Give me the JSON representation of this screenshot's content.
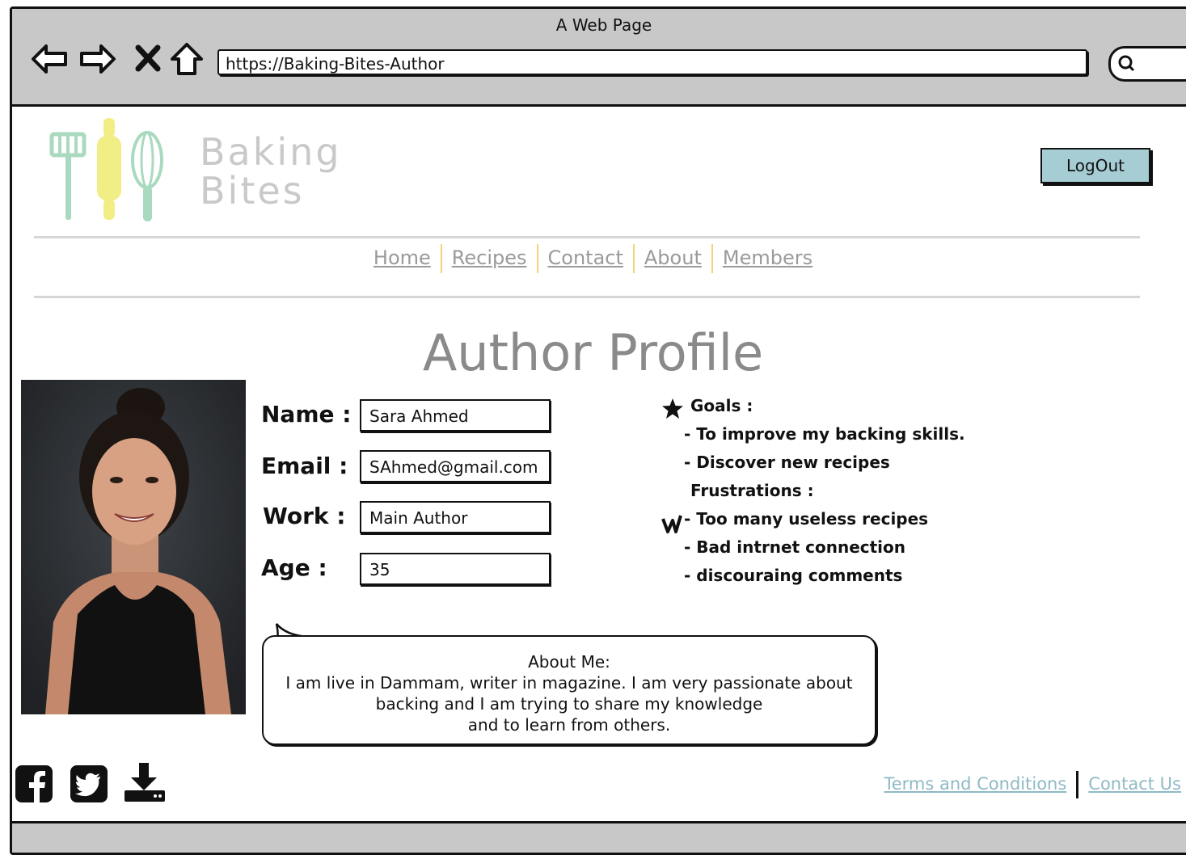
{
  "window": {
    "title": "A Web Page"
  },
  "browser": {
    "url": "https://Baking-Bites-Author"
  },
  "logo": {
    "line1": "Baking",
    "line2": "Bites"
  },
  "header": {
    "logout_label": "LogOut"
  },
  "nav": {
    "items": [
      "Home",
      "Recipes",
      "Contact",
      "About",
      "Members"
    ]
  },
  "page": {
    "title": "Author Profile"
  },
  "profile": {
    "name_label": "Name :",
    "name_value": "Sara Ahmed",
    "email_label": "Email :",
    "email_value": "SAhmed@gmail.com",
    "work_label": "Work :",
    "work_value": "Main Author",
    "age_label": "Age :",
    "age_value": "35"
  },
  "notes": {
    "goals_title": "Goals :",
    "goals": [
      "- To improve my backing skills.",
      "- Discover new recipes"
    ],
    "frustrations_title": "Frustrations :",
    "frustrations": [
      "- Too many useless recipes",
      "- Bad intrnet connection",
      "- discouraing comments"
    ]
  },
  "about": {
    "title": "About Me:",
    "lines": [
      "I am live in Dammam, writer in magazine. I am very passionate about",
      "backing and I am trying to share my knowledge",
      "and to learn from others."
    ]
  },
  "footer": {
    "terms": "Terms and Conditions",
    "contact": "Contact Us"
  },
  "icons": [
    "facebook-icon",
    "twitter-icon",
    "download-icon"
  ],
  "colors": {
    "logout_bg": "#a6ccd4",
    "nav_sep": "#f2d27a",
    "footer_link": "#8fbac5"
  }
}
